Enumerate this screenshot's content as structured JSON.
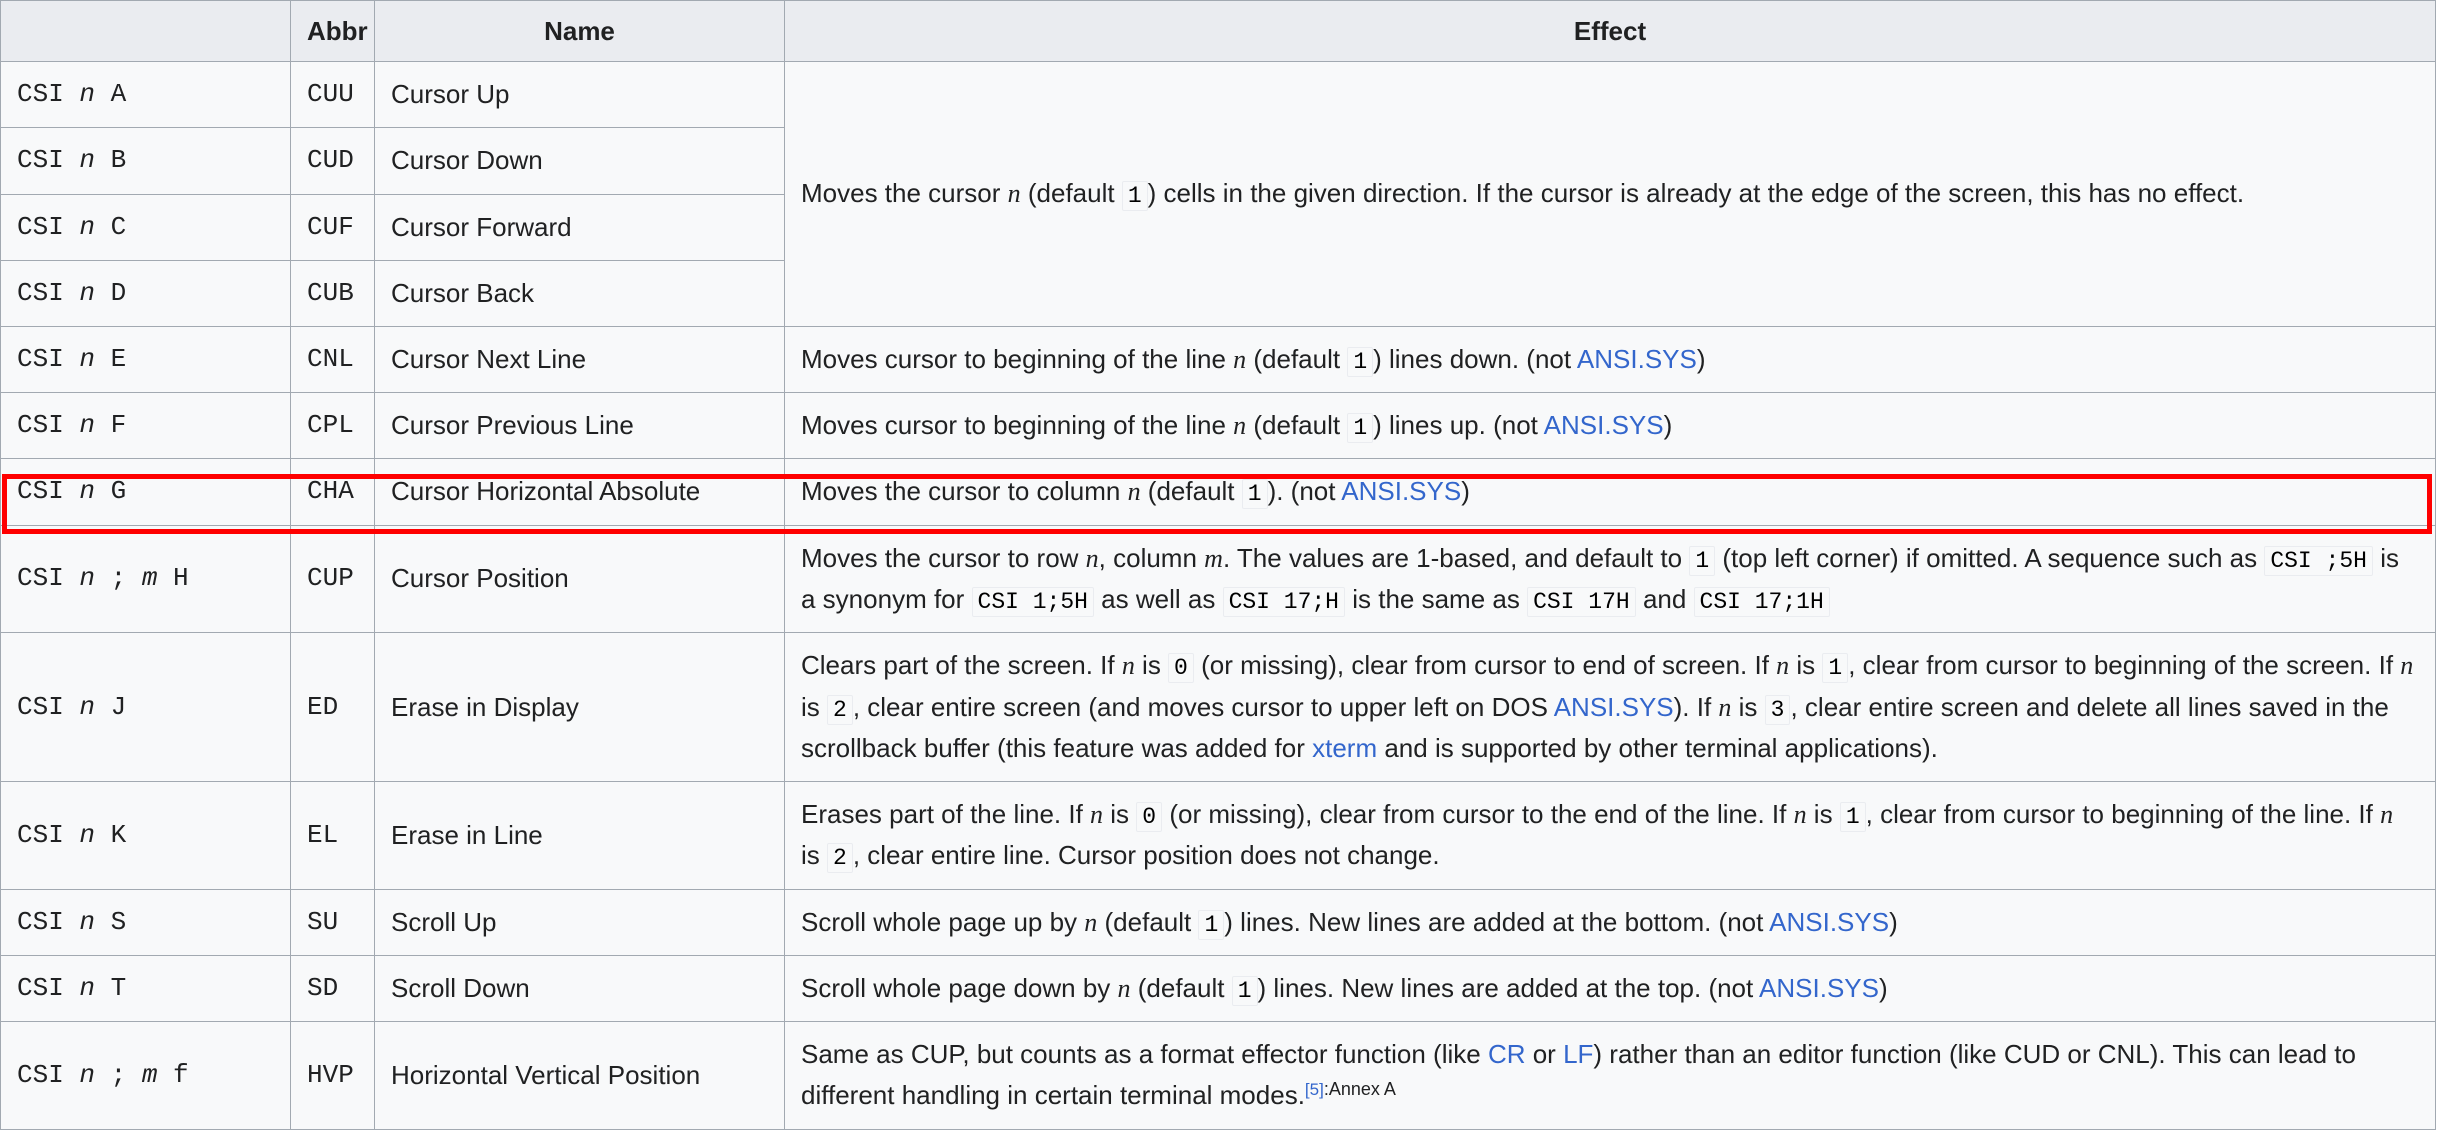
{
  "table": {
    "headers": [
      "",
      "Abbr",
      "Name",
      "Effect"
    ],
    "rows": [
      {
        "code_prefix": "CSI ",
        "code_var": "n",
        "code_suffix": " A",
        "abbr": "CUU",
        "name": "Cursor Up",
        "effect_group": "move",
        "group_first": true,
        "group_rowspan": 4,
        "effect_text": "Moves the cursor n (default 1 ) cells in the given direction. If the cursor is already at the edge of the screen, this has no effect."
      },
      {
        "code_prefix": "CSI ",
        "code_var": "n",
        "code_suffix": " B",
        "abbr": "CUD",
        "name": "Cursor Down",
        "effect_group": "move",
        "group_first": false
      },
      {
        "code_prefix": "CSI ",
        "code_var": "n",
        "code_suffix": " C",
        "abbr": "CUF",
        "name": "Cursor Forward",
        "effect_group": "move",
        "group_first": false
      },
      {
        "code_prefix": "CSI ",
        "code_var": "n",
        "code_suffix": " D",
        "abbr": "CUB",
        "name": "Cursor Back",
        "effect_group": "move",
        "group_first": false
      },
      {
        "code_prefix": "CSI ",
        "code_var": "n",
        "code_suffix": " E",
        "abbr": "CNL",
        "name": "Cursor Next Line",
        "effect_text": "Moves cursor to beginning of the line n (default 1 ) lines down. (not ANSI.SYS)"
      },
      {
        "code_prefix": "CSI ",
        "code_var": "n",
        "code_suffix": " F",
        "abbr": "CPL",
        "name": "Cursor Previous Line",
        "effect_text": "Moves cursor to beginning of the line n (default 1 ) lines up. (not ANSI.SYS)"
      },
      {
        "code_prefix": "CSI ",
        "code_var": "n",
        "code_suffix": " G",
        "abbr": "CHA",
        "name": "Cursor Horizontal Absolute",
        "effect_text": "Moves the cursor to column n (default 1 ). (not ANSI.SYS)"
      },
      {
        "code_prefix": "CSI ",
        "code_var": "n",
        "code_mid": " ; ",
        "code_var2": "m",
        "code_suffix": " H",
        "abbr": "CUP",
        "name": "Cursor Position",
        "highlighted": true,
        "effect_text": "Moves the cursor to row n, column m. The values are 1-based, and default to 1 (top left corner) if omitted. A sequence such as CSI ;5H is a synonym for CSI 1;5H as well as CSI 17;H is the same as CSI 17H and CSI 17;1H"
      },
      {
        "code_prefix": "CSI ",
        "code_var": "n",
        "code_suffix": " J",
        "abbr": "ED",
        "name": "Erase in Display",
        "effect_text": "Clears part of the screen. If n is 0 (or missing), clear from cursor to end of screen. If n is 1 , clear from cursor to beginning of the screen. If n is 2 , clear entire screen (and moves cursor to upper left on DOS ANSI.SYS). If n is 3 , clear entire screen and delete all lines saved in the scrollback buffer (this feature was added for xterm and is supported by other terminal applications)."
      },
      {
        "code_prefix": "CSI ",
        "code_var": "n",
        "code_suffix": " K",
        "abbr": "EL",
        "name": "Erase in Line",
        "effect_text": "Erases part of the line. If n is 0 (or missing), clear from cursor to the end of the line. If n is 1 , clear from cursor to beginning of the line. If n is 2 , clear entire line. Cursor position does not change."
      },
      {
        "code_prefix": "CSI ",
        "code_var": "n",
        "code_suffix": " S",
        "abbr": "SU",
        "name": "Scroll Up",
        "effect_text": "Scroll whole page up by n (default 1 ) lines. New lines are added at the bottom. (not ANSI.SYS)"
      },
      {
        "code_prefix": "CSI ",
        "code_var": "n",
        "code_suffix": " T",
        "abbr": "SD",
        "name": "Scroll Down",
        "effect_text": "Scroll whole page down by n (default 1 ) lines. New lines are added at the top. (not ANSI.SYS)"
      },
      {
        "code_prefix": "CSI ",
        "code_var": "n",
        "code_mid": " ; ",
        "code_var2": "m",
        "code_suffix": " f",
        "abbr": "HVP",
        "name": "Horizontal Vertical Position",
        "effect_text": "Same as CUP, but counts as a format effector function (like CR or LF) rather than an editor function (like CUD or CNL). This can lead to different handling in certain terminal modes.[5]:Annex A"
      }
    ]
  },
  "fragments": {
    "csi": "CSI",
    "var_n": "n",
    "var_m": "m",
    "default_0": "0",
    "default_1": "1",
    "default_2": "2",
    "default_3": "3",
    "code_csi_5h": "CSI ;5H",
    "code_csi_1_5h": "CSI 1;5H",
    "code_csi_17semi_h": "CSI 17;H",
    "code_csi_17h": "CSI 17H",
    "code_csi_17_1h": "CSI 17;1H",
    "link_ansisys": "ANSI.SYS",
    "link_xterm": "xterm",
    "link_cr": "CR",
    "link_lf": "LF",
    "ref_5": "[5]",
    "ref_page": ":Annex A"
  },
  "text": {
    "move_p1": "Moves the cursor ",
    "move_p2": " (default ",
    "move_p3": ") cells in the given direction. If the cursor is already at the edge of the screen, this has no effect.",
    "cnl_p1": "Moves cursor to beginning of the line ",
    "cnl_p2": " (default ",
    "cnl_p3": ") lines down. (not ",
    "cnl_p4": ")",
    "cpl_p3": ") lines up. (not ",
    "cha_p1": "Moves the cursor to column ",
    "cha_p2": " (default ",
    "cha_p3": "). (not ",
    "cup_p1": "Moves the cursor to row ",
    "cup_p2": ", column ",
    "cup_p3": ". The values are 1-based, and default to ",
    "cup_p4": "(top left corner) if omitted. A sequence such as ",
    "cup_p5": "is a synonym for ",
    "cup_p6": "as well as ",
    "cup_p7": "is the same as ",
    "cup_p8": "and ",
    "ed_p1": "Clears part of the screen. If ",
    "ed_p2": " is ",
    "ed_p3": "(or missing), clear from cursor to end of screen. If ",
    "ed_p4": " is ",
    "ed_p5": ", clear from cursor to beginning of the screen. If ",
    "ed_p6": " is ",
    "ed_p7": ", clear entire screen (and moves cursor to upper left on DOS ",
    "ed_p8": "). If ",
    "ed_p9": " is ",
    "ed_p10": ", clear entire screen and delete all lines saved in the scrollback buffer (this feature was added for ",
    "ed_p11": " and is supported by other terminal applications).",
    "el_p1": "Erases part of the line. If ",
    "el_p2": " is ",
    "el_p3": "(or missing), clear from cursor to the end of the line. If ",
    "el_p4": " is ",
    "el_p5": ", clear from cursor to beginning of the line. If ",
    "el_p6": " is ",
    "el_p7": ", clear entire line. Cursor position does not change.",
    "su_p1": "Scroll whole page up by ",
    "su_p2": " (default ",
    "su_p3": ") lines. New lines are added at the bottom. (not ",
    "su_p4": ")",
    "sd_p1": "Scroll whole page down by ",
    "sd_p3": ") lines. New lines are added at the top. (not ",
    "hvp_p1": "Same as CUP, but counts as a format effector function (like ",
    "hvp_p2": " or ",
    "hvp_p3": ") rather than an editor function (like CUD or CNL). This can lead to different handling in certain terminal modes."
  },
  "colors": {
    "link": "#3366cc",
    "highlight_border": "#ff0000",
    "header_bg": "#eaecf0",
    "cell_bg": "#f8f9fa",
    "border": "#a2a9b1"
  }
}
